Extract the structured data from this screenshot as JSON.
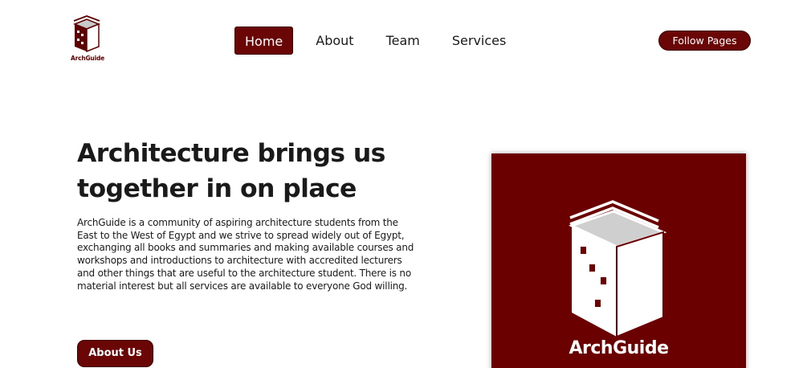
{
  "brand": {
    "logo_text": "ArchGuide",
    "card_name": "ArchGuide",
    "color": "#6b0000"
  },
  "nav": {
    "items": [
      {
        "label": "Home",
        "active": true
      },
      {
        "label": "About",
        "active": false
      },
      {
        "label": "Team",
        "active": false
      },
      {
        "label": "Services",
        "active": false
      }
    ]
  },
  "header": {
    "follow_label": "Follow Pages"
  },
  "hero": {
    "title_line1": "Architecture brings us",
    "title_line2": "together in on place",
    "description": "ArchGuide is a community of aspiring architecture students from the East to the West of Egypt and we strive to spread widely out of Egypt, exchanging all books and summaries and making available courses and workshops and introductions to architecture with accredited lecturers and other things that are useful to the architecture student. There is no material interest but all services are available to everyone God willing.",
    "button_label": "About Us"
  }
}
